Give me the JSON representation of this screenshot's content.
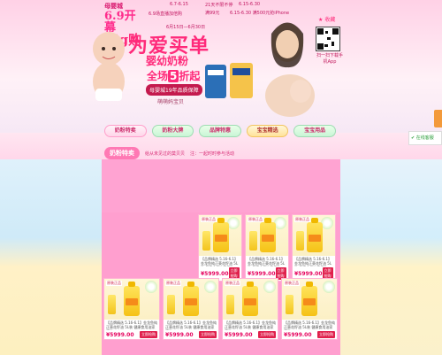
{
  "banner": {
    "logo_top": "母婴城",
    "logo_mid": "6.9开幕",
    "logo_sub": "hig购节",
    "sub_date": "6.9场直播加倍购",
    "dates_a": "6.7-6.15",
    "dates_b": "6月15日—6月30日",
    "promo_line_1": "21天不限不停",
    "promo_line_2": "6.15-6.30",
    "promo_line_3": "满99元",
    "promo_line_4": "6.15-6.30 满500元抢iPhone",
    "hero_title": "为爱买单",
    "subtitle": "婴幼奶粉",
    "deal_prefix": "全场",
    "deal_num": "5",
    "deal_suffix": "折起",
    "badge": "母婴城19年品质保障",
    "tagline": "萌萌妈宝贝",
    "favorite": "收藏",
    "qr_text": "扫一扫下载手机App"
  },
  "tabs": [
    {
      "label": "奶粉特卖"
    },
    {
      "label": "奶粉大牌"
    },
    {
      "label": "品牌特惠"
    },
    {
      "label": "宝宝精选"
    },
    {
      "label": "宝宝用品"
    }
  ],
  "section": {
    "label": "奶粉特卖",
    "sub": "给从未见过的莫贝贝",
    "note": "注：一起时时参与活动"
  },
  "products": [
    {
      "title": "【品牌精选 5.16-6.1】金龙鱼纯正葵花籽油 5L装 健康食用油家庭装",
      "price": "¥5999.00",
      "buy": "立即抢购",
      "badge": "原装正品"
    },
    {
      "title": "【品牌精选 5.16-6.1】金龙鱼纯正葵花籽油 5L装 健康食用油家庭装",
      "price": "¥5999.00",
      "buy": "立即抢购",
      "badge": "原装正品"
    },
    {
      "title": "【品牌精选 5.16-6.1】金龙鱼纯正葵花籽油 5L装 健康食用油家庭装",
      "price": "¥5999.00",
      "buy": "立即抢购",
      "badge": "原装正品"
    },
    {
      "title": "【品牌精选 5.16-6.1】金龙鱼纯正葵花籽油 5L装 健康食用油家庭装",
      "price": "¥5999.00",
      "buy": "立即抢购",
      "badge": "原装正品"
    },
    {
      "title": "【品牌精选 5.16-6.1】金龙鱼纯正葵花籽油 5L装 健康食用油家庭装",
      "price": "¥5999.00",
      "buy": "立即抢购",
      "badge": "原装正品"
    },
    {
      "title": "【品牌精选 5.16-6.1】金龙鱼纯正葵花籽油 5L装 健康食用油家庭装",
      "price": "¥5999.00",
      "buy": "立即抢购",
      "badge": "原装正品"
    },
    {
      "title": "【品牌精选 5.16-6.1】金龙鱼纯正葵花籽油 5L装 健康食用油家庭装",
      "price": "¥5999.00",
      "buy": "立即抢购",
      "badge": "原装正品"
    }
  ],
  "side": {
    "service_label": "在线客服"
  },
  "colors": {
    "brand": "#ff2a7a",
    "accent_green": "#2a9d39",
    "price": "#e6005c"
  }
}
